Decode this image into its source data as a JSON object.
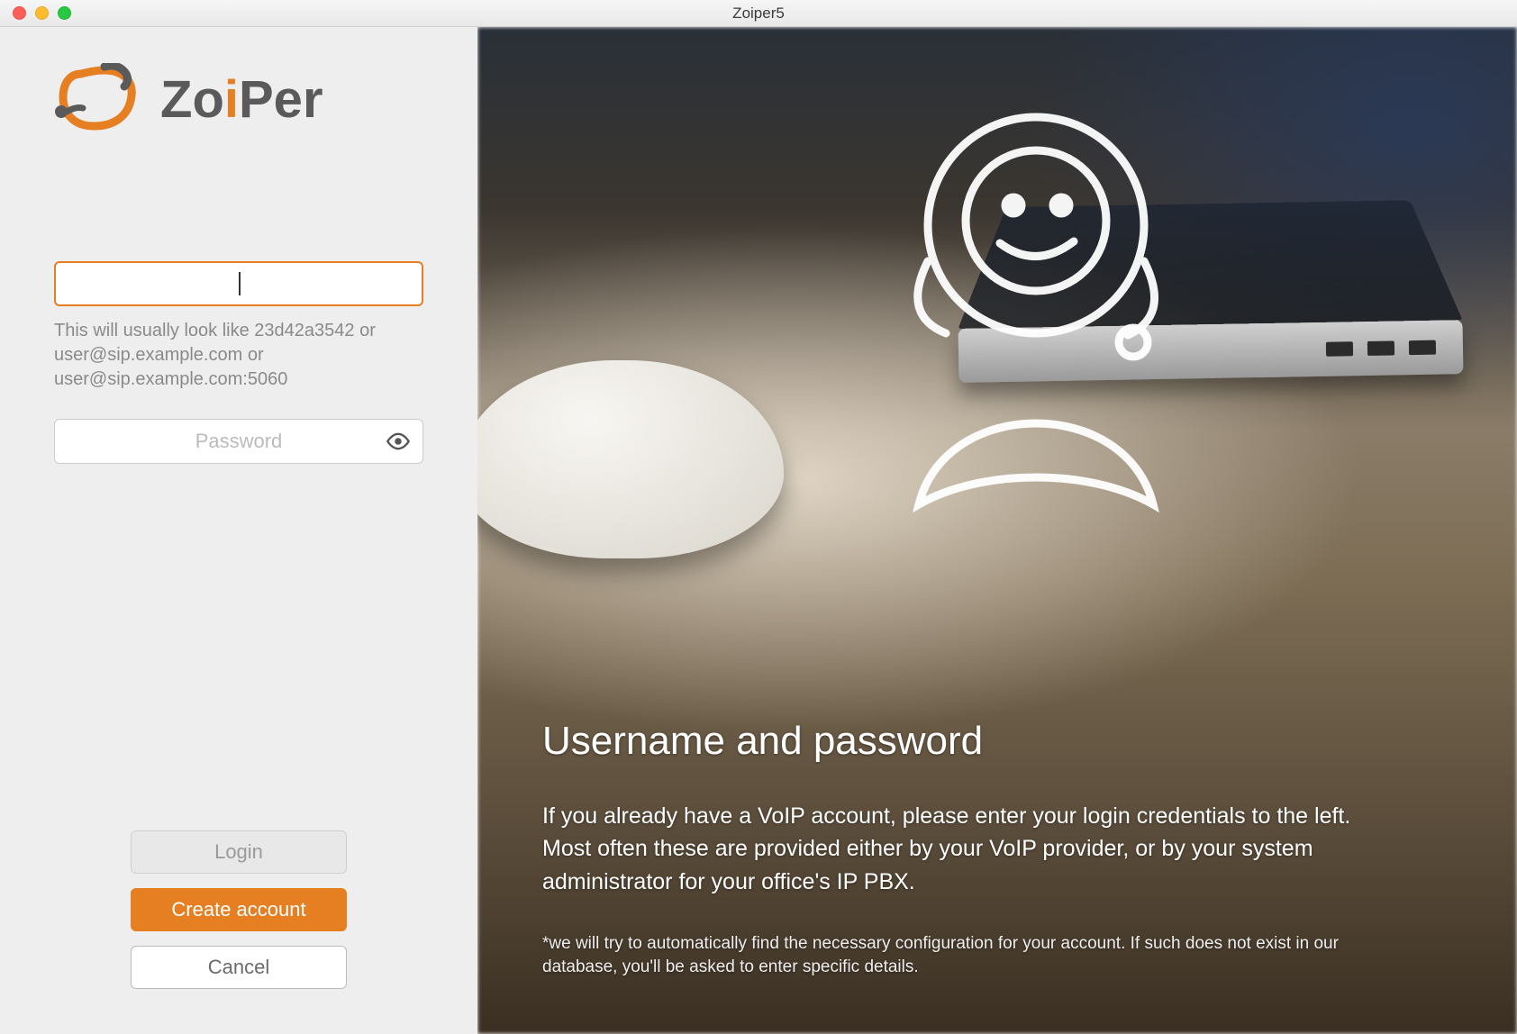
{
  "window": {
    "title": "Zoiper5"
  },
  "logo": {
    "text_prefix": "Z",
    "text_oi": "oi",
    "text_suffix": "Per"
  },
  "form": {
    "username_value": "",
    "username_hint": "This will usually look like 23d42a3542 or user@sip.example.com or user@sip.example.com:5060",
    "password_placeholder": "Password"
  },
  "buttons": {
    "login": "Login",
    "create": "Create account",
    "cancel": "Cancel"
  },
  "info": {
    "heading": "Username and password",
    "body": " If you already have a VoIP account, please enter your login credentials to the left.\nMost often these are provided either by your VoIP provider, or by your system administrator for your office's IP PBX.",
    "note": "*we will try to automatically find the necessary configuration for your account. If such does not exist in our database, you'll be asked to enter specific details."
  },
  "colors": {
    "accent": "#e67e22"
  }
}
